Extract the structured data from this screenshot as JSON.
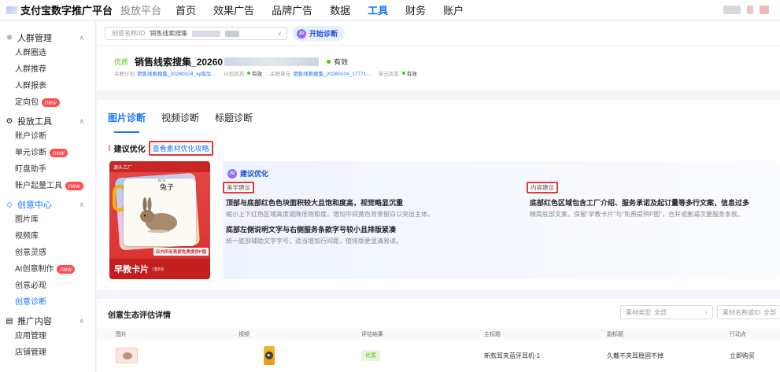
{
  "topbar": {
    "brand": "支付宝数字推广平台",
    "subbrand": "投放平台",
    "nav": [
      "首页",
      "效果广告",
      "品牌广告",
      "数据",
      "工具",
      "财务",
      "账户"
    ],
    "active_nav": "工具"
  },
  "sidebar": {
    "groups": [
      {
        "label": "人群管理",
        "icon": "crowd-icon",
        "items": [
          {
            "label": "人群圈选"
          },
          {
            "label": "人群推荐"
          },
          {
            "label": "人群报表"
          },
          {
            "label": "定向包",
            "badge": "new"
          }
        ]
      },
      {
        "label": "投放工具",
        "icon": "tool-icon",
        "items": [
          {
            "label": "账户诊断"
          },
          {
            "label": "单元诊断",
            "badge": "new"
          },
          {
            "label": "盯盘助手"
          },
          {
            "label": "账户起量工具",
            "badge": "new"
          }
        ]
      },
      {
        "label": "创意中心",
        "icon": "creative-icon",
        "items": [
          {
            "label": "图片库"
          },
          {
            "label": "视频库"
          },
          {
            "label": "创意灵感"
          },
          {
            "label": "AI创意制作",
            "badge": "new"
          },
          {
            "label": "创意必现"
          },
          {
            "label": "创意诊断"
          }
        ]
      },
      {
        "label": "推广内容",
        "icon": "content-icon",
        "items": [
          {
            "label": "应用管理"
          },
          {
            "label": "店铺管理"
          }
        ]
      }
    ]
  },
  "filter": {
    "label": "创意名称/ID",
    "value": "销售线索搜集",
    "diagnose_button": "开始诊断"
  },
  "creative": {
    "tag": "优质",
    "name": "销售线索搜集_20260",
    "status": "有效",
    "meta": {
      "plan_label": "关联计划",
      "plan_value": "销售线索搜集_20260104_xy取生...",
      "plan_status_label": "计划状态",
      "plan_status": "有效",
      "unit_label": "关联单元",
      "unit_value": "销售线索搜集_20260104_17771...",
      "unit_status_label": "单元状态",
      "unit_status": "有效"
    }
  },
  "diagnosis": {
    "tabs": [
      "图片诊断",
      "视频诊断",
      "标题诊断"
    ],
    "active_tab": "图片诊断",
    "suggest_title": "建议优化",
    "guide_link": "查看素材优化攻略",
    "thumbnail": {
      "top_text": "源头工厂",
      "word": "兔子",
      "pinyin": "tù zi",
      "strip": "店内所有卖家免费提供P图",
      "bottom": "早教卡片",
      "bottom_sub": "1套8张"
    },
    "ai_title": "建议优化",
    "categories": [
      {
        "tag": "美学建议",
        "items": [
          {
            "title": "顶部与底部红色色块面积较大且饱和度高，视觉略显沉重",
            "desc": "缩小上下红色区域高度或降低饱和度，增加中间黄色背景留白以突出主体。"
          },
          {
            "title": "底部左侧说明文字与右侧服务条款字号较小且排版紧凑",
            "desc": "统一底部辅助文字字号，适当增加行间距，使排版更显清易读。"
          }
        ]
      },
      {
        "tag": "内容建议",
        "items": [
          {
            "title": "底部红色区域包含工厂介绍、服务承诺及起订量等多行文案，信息过多",
            "desc": "精简底部文案，保留“早教卡片”与“免费提供P图”，合并或删减次要服务条款。"
          }
        ]
      }
    ]
  },
  "evaluation": {
    "title": "创意生态评估详情",
    "filter_type_label": "素材类型",
    "filter_type_value": "全部",
    "filter_name_placeholder": "素材名称或ID",
    "filter_name_value": "全部",
    "columns": [
      "图片",
      "视频",
      "评估结果",
      "主标题",
      "副标题",
      "行动点"
    ],
    "rows": [
      {
        "result": "优质",
        "main_title": "新款耳夹蓝牙耳机-1",
        "sub_title": "久戴不夹耳稳固不掉",
        "action": "立即购买"
      }
    ]
  },
  "colors": {
    "brand_blue": "#1677ff",
    "alert_red": "#e53935",
    "good_green": "#52c41a"
  }
}
